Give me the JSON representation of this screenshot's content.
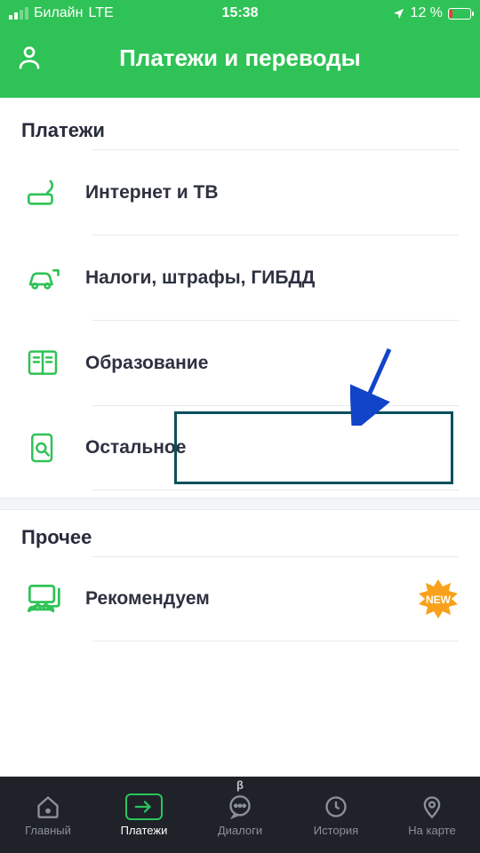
{
  "status": {
    "carrier": "Билайн",
    "network": "LTE",
    "time": "15:38",
    "battery_pct": "12 %"
  },
  "header": {
    "title": "Платежи и переводы"
  },
  "sections": {
    "payments": {
      "title": "Платежи",
      "items": [
        {
          "label": "Интернет и ТВ",
          "icon": "router-icon"
        },
        {
          "label": "Налоги, штрафы, ГИБДД",
          "icon": "car-icon"
        },
        {
          "label": "Образование",
          "icon": "book-icon"
        },
        {
          "label": "Остальное",
          "icon": "search-doc-icon"
        }
      ]
    },
    "other": {
      "title": "Прочее",
      "items": [
        {
          "label": "Рекомендуем",
          "icon": "gamepad-icon",
          "badge": "NEW"
        }
      ]
    }
  },
  "nav": {
    "items": [
      {
        "label": "Главный"
      },
      {
        "label": "Платежи"
      },
      {
        "label": "Диалоги",
        "beta": "β"
      },
      {
        "label": "История"
      },
      {
        "label": "На карте"
      }
    ],
    "active_index": 1
  },
  "colors": {
    "accent": "#2fc256",
    "highlight": "#0a4f5c",
    "badge": "#f9a11a"
  }
}
